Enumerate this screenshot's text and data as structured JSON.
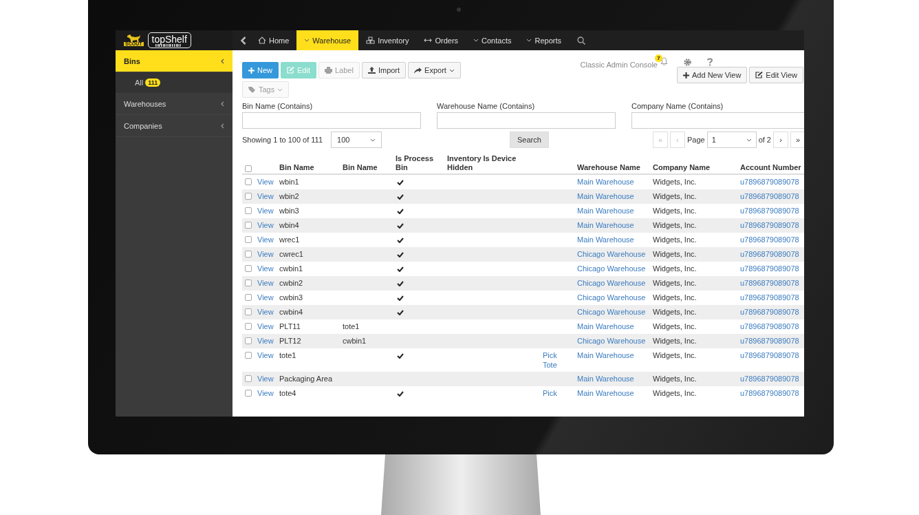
{
  "logo": {
    "badge": "SCOUT",
    "name": "topShelf"
  },
  "nav": {
    "items": [
      {
        "label": "Home",
        "kind": "home",
        "selected": false
      },
      {
        "label": "Warehouse",
        "kind": "dropdown",
        "selected": true
      },
      {
        "label": "Inventory",
        "kind": "cubes",
        "selected": false
      },
      {
        "label": "Orders",
        "kind": "arrows",
        "selected": false
      },
      {
        "label": "Contacts",
        "kind": "dropdown",
        "selected": false
      },
      {
        "label": "Reports",
        "kind": "dropdown",
        "selected": false
      }
    ]
  },
  "sidebar": {
    "items": [
      {
        "label": "Bins",
        "selected": true,
        "children": [
          {
            "label": "All",
            "count": "111"
          }
        ]
      },
      {
        "label": "Warehouses",
        "selected": false
      },
      {
        "label": "Companies",
        "selected": false
      }
    ]
  },
  "toolbar": {
    "buttons": [
      {
        "label": "New",
        "kind": "plus",
        "disabled": false,
        "dropdown": false
      },
      {
        "label": "Edit",
        "kind": "edit",
        "disabled": true,
        "dropdown": false
      },
      {
        "label": "Label",
        "kind": "print",
        "disabled": true,
        "dropdown": false
      },
      {
        "label": "Import",
        "kind": "upload",
        "disabled": false,
        "dropdown": false
      },
      {
        "label": "Export",
        "kind": "share",
        "disabled": false,
        "dropdown": true
      },
      {
        "label": "Tags",
        "kind": "tag",
        "disabled": true,
        "dropdown": true
      }
    ]
  },
  "header": {
    "console_link": "Classic Admin Console",
    "notifications": "7",
    "buttons": [
      {
        "label": "Add New View",
        "kind": "plus"
      },
      {
        "label": "Edit View",
        "kind": "edit"
      }
    ]
  },
  "filters": [
    {
      "label": "Bin Name (Contains)"
    },
    {
      "label": "Warehouse Name (Contains)"
    },
    {
      "label": "Company Name (Contains)"
    }
  ],
  "results": {
    "summary": "Showing 1 to 100 of 111",
    "page_size": "100",
    "search_button": "Search"
  },
  "pagination": {
    "first": "«",
    "prev": "‹",
    "label": "Page",
    "page": "1",
    "of": "of 2",
    "next": "›",
    "last": "»"
  },
  "table": {
    "select_all_checked": false,
    "columns": [
      "Bin Name",
      "Bin Name",
      "Is Process Bin",
      "Inventory Is Device Hidden",
      "Warehouse Name",
      "Company Name",
      "Account Number"
    ],
    "rows": [
      {
        "checked": false,
        "link": "View",
        "bin_name": "wbin1",
        "process_bin": true,
        "warehouse": "Main Warehouse",
        "company": "Widgets, Inc.",
        "account": "u7896879089078"
      },
      {
        "checked": false,
        "link": "View",
        "bin_name": "wbin2",
        "process_bin": true,
        "warehouse": "Main Warehouse",
        "company": "Widgets, Inc.",
        "account": "u7896879089078"
      },
      {
        "checked": false,
        "link": "View",
        "bin_name": "wbin3",
        "process_bin": true,
        "warehouse": "Main Warehouse",
        "company": "Widgets, Inc.",
        "account": "u7896879089078"
      },
      {
        "checked": false,
        "link": "View",
        "bin_name": "wbin4",
        "process_bin": true,
        "warehouse": "Main Warehouse",
        "company": "Widgets, Inc.",
        "account": "u7896879089078"
      },
      {
        "checked": false,
        "link": "View",
        "bin_name": "wrec1",
        "process_bin": true,
        "warehouse": "Main Warehouse",
        "company": "Widgets, Inc.",
        "account": "u7896879089078"
      },
      {
        "checked": false,
        "link": "View",
        "bin_name": "cwrec1",
        "process_bin": true,
        "warehouse": "Chicago Warehouse",
        "company": "Widgets, Inc.",
        "account": "u7896879089078"
      },
      {
        "checked": false,
        "link": "View",
        "bin_name": "cwbin1",
        "process_bin": true,
        "warehouse": "Chicago Warehouse",
        "company": "Widgets, Inc.",
        "account": "u7896879089078"
      },
      {
        "checked": false,
        "link": "View",
        "bin_name": "cwbin2",
        "process_bin": true,
        "warehouse": "Chicago Warehouse",
        "company": "Widgets, Inc.",
        "account": "u7896879089078"
      },
      {
        "checked": false,
        "link": "View",
        "bin_name": "cwbin3",
        "process_bin": true,
        "warehouse": "Chicago Warehouse",
        "company": "Widgets, Inc.",
        "account": "u7896879089078"
      },
      {
        "checked": false,
        "link": "View",
        "bin_name": "cwbin4",
        "process_bin": true,
        "warehouse": "Chicago Warehouse",
        "company": "Widgets, Inc.",
        "account": "u7896879089078"
      },
      {
        "checked": false,
        "link": "View",
        "bin_name": "PLT11",
        "bin_name_2": "tote1",
        "process_bin": false,
        "warehouse": "Main Warehouse",
        "company": "Widgets, Inc.",
        "account": "u7896879089078"
      },
      {
        "checked": false,
        "link": "View",
        "bin_name": "PLT12",
        "bin_name_2": "cwbin1",
        "process_bin": false,
        "warehouse": "Chicago Warehouse",
        "company": "Widgets, Inc.",
        "account": "u7896879089078"
      },
      {
        "checked": false,
        "link": "View",
        "bin_name": "tote1",
        "process_bin": true,
        "column_6": "Pick Tote",
        "warehouse": "Main Warehouse",
        "company": "Widgets, Inc.",
        "account": "u7896879089078"
      },
      {
        "checked": false,
        "link": "View",
        "bin_name": "Packaging Area",
        "process_bin": false,
        "warehouse": "Main Warehouse",
        "company": "Widgets, Inc.",
        "account": "u7896879089078"
      },
      {
        "checked": false,
        "link": "View",
        "bin_name": "tote4",
        "process_bin": true,
        "column_6": "Pick",
        "warehouse": "Main Warehouse",
        "company": "Widgets, Inc.",
        "account": "u7896879089078"
      }
    ]
  }
}
